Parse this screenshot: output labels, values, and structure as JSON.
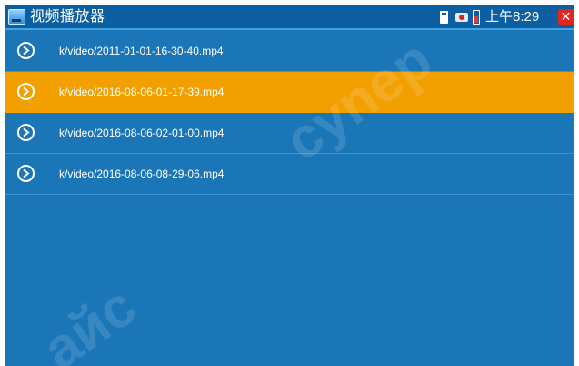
{
  "window": {
    "title": "视频播放器",
    "clock": "上午8:29",
    "close_label": "✕"
  },
  "files": [
    {
      "name": "k/video/2011-01-01-16-30-40.mp4",
      "selected": false
    },
    {
      "name": "k/video/2016-08-06-01-17-39.mp4",
      "selected": true
    },
    {
      "name": "k/video/2016-08-06-02-01-00.mp4",
      "selected": false
    },
    {
      "name": "k/video/2016-08-06-08-29-06.mp4",
      "selected": false
    }
  ],
  "colors": {
    "background": "#1b76b8",
    "titlebar": "#0c5fa0",
    "selection": "#f2a000",
    "close": "#e0261f"
  },
  "icons": {
    "app": "video-player-icon",
    "sd": "sd-card-icon",
    "network": "network-icon",
    "battery": "battery-icon",
    "row": "play-arrow-icon"
  }
}
